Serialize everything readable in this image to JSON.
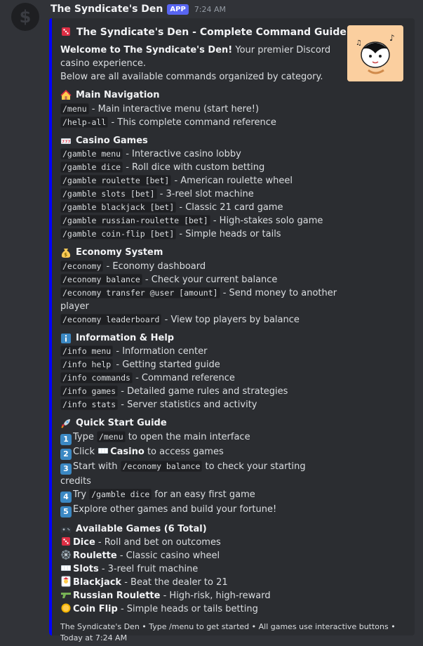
{
  "message": {
    "username": "The Syndicate's Den",
    "badge": "APP",
    "timestamp": "7:24 AM"
  },
  "embed": {
    "title": "The Syndicate's Den - Complete Command Guide",
    "welcome_bold": "Welcome to The Syndicate's Den!",
    "welcome_rest": " Your premier Discord casino experience.",
    "intro": "Below are all available commands organized by category.",
    "sections": {
      "nav": {
        "title": "Main Navigation",
        "items": [
          {
            "cmd": "/menu",
            "desc": " - Main interactive menu (start here!)"
          },
          {
            "cmd": "/help-all",
            "desc": " - This complete command reference"
          }
        ]
      },
      "casino": {
        "title": "Casino Games",
        "items": [
          {
            "cmd": "/gamble menu",
            "desc": " - Interactive casino lobby"
          },
          {
            "cmd": "/gamble dice",
            "desc": " - Roll dice with custom betting"
          },
          {
            "cmd": "/gamble roulette [bet]",
            "desc": " - American roulette wheel"
          },
          {
            "cmd": "/gamble slots [bet]",
            "desc": " - 3-reel slot machine"
          },
          {
            "cmd": "/gamble blackjack [bet]",
            "desc": " - Classic 21 card game"
          },
          {
            "cmd": "/gamble russian-roulette [bet]",
            "desc": " - High-stakes solo game"
          },
          {
            "cmd": "/gamble coin-flip [bet]",
            "desc": " - Simple heads or tails"
          }
        ]
      },
      "economy": {
        "title": "Economy System",
        "items": [
          {
            "cmd": "/economy",
            "desc": " - Economy dashboard"
          },
          {
            "cmd": "/economy balance",
            "desc": " - Check your current balance"
          },
          {
            "cmd": "/economy transfer @user [amount]",
            "desc": " - Send money to another player"
          },
          {
            "cmd": "/economy leaderboard",
            "desc": " - View top players by balance"
          }
        ]
      },
      "info": {
        "title": "Information & Help",
        "items": [
          {
            "cmd": "/info menu",
            "desc": " - Information center"
          },
          {
            "cmd": "/info help",
            "desc": " - Getting started guide"
          },
          {
            "cmd": "/info commands",
            "desc": " - Command reference"
          },
          {
            "cmd": "/info games",
            "desc": " - Detailed game rules and strategies"
          },
          {
            "cmd": "/info stats",
            "desc": " - Server statistics and activity"
          }
        ]
      },
      "quick": {
        "title": "Quick Start Guide",
        "steps": [
          {
            "n": "1",
            "pre": "Type ",
            "cmd": "/menu",
            "post": " to open the main interface"
          },
          {
            "n": "2",
            "pre": "Click ",
            "bold": "Casino",
            "post": " to access games"
          },
          {
            "n": "3",
            "pre": "Start with ",
            "cmd": "/economy balance",
            "post": " to check your starting credits"
          },
          {
            "n": "4",
            "pre": "Try ",
            "cmd": "/gamble dice",
            "post": " for an easy first game"
          },
          {
            "n": "5",
            "pre": "Explore other games and build your fortune!"
          }
        ]
      },
      "games": {
        "title": "Available Games (6 Total)",
        "items": [
          {
            "name": "Dice",
            "desc": " - Roll and bet on outcomes",
            "icon": "dice-icon"
          },
          {
            "name": "Roulette",
            "desc": " - Classic casino wheel",
            "icon": "roulette-wheel-icon"
          },
          {
            "name": "Slots",
            "desc": " - 3-reel fruit machine",
            "icon": "slot-machine-icon"
          },
          {
            "name": "Blackjack",
            "desc": " - Beat the dealer to 21",
            "icon": "joker-card-icon"
          },
          {
            "name": "Russian Roulette",
            "desc": " - High-risk, high-reward",
            "icon": "pistol-icon"
          },
          {
            "name": "Coin Flip",
            "desc": " - Simple heads or tails betting",
            "icon": "coin-icon"
          }
        ]
      }
    },
    "footer": "The Syndicate's Den • Type /menu to get started • All games use interactive buttons •  Today at 7:24 AM"
  },
  "colors": {
    "embed_border": "#0000ff",
    "badge": "#5865f2",
    "background": "#313338",
    "embed_bg": "#2b2d31"
  }
}
